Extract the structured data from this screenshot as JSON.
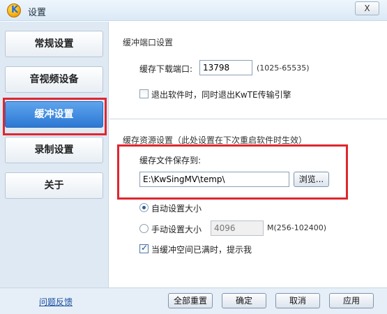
{
  "window": {
    "title": "设置",
    "close_glyph": "X"
  },
  "sidebar": {
    "items": [
      {
        "label": "常规设置",
        "active": false
      },
      {
        "label": "音视频设备",
        "active": false
      },
      {
        "label": "缓冲设置",
        "active": true
      },
      {
        "label": "录制设置",
        "active": false
      },
      {
        "label": "关于",
        "active": false
      }
    ]
  },
  "buffer_port": {
    "section_title": "缓冲端口设置",
    "port_label": "缓存下载端口:",
    "port_value": "13798",
    "port_range": "(1025-65535)",
    "exit_checkbox_label": "退出软件时，同时退出KwTE传输引擎",
    "exit_checkbox_checked": false
  },
  "buffer_resource": {
    "section_title": "缓存资源设置（此处设置在下次重启软件时生效）",
    "save_to_label": "缓存文件保存到:",
    "path_value": "E:\\KwSingMV\\temp\\",
    "browse_label": "浏览...",
    "auto_size_label": "自动设置大小",
    "auto_size_selected": true,
    "manual_size_label": "手动设置大小",
    "manual_size_selected": false,
    "manual_size_value": "4096",
    "manual_size_range": "M(256-102400)",
    "notify_full_label": "当缓冲空间已满时，提示我",
    "notify_full_checked": true
  },
  "footer": {
    "feedback_link": "问题反馈",
    "reset_all_label": "全部重置",
    "ok_label": "确定",
    "cancel_label": "取消",
    "apply_label": "应用"
  },
  "colors": {
    "highlight_box": "#e0262e",
    "active_tab": "#2c78d4",
    "sidebar_bg": "#dfe9f4"
  },
  "icons": {
    "app": "kwsing-logo-icon",
    "close": "close-icon"
  }
}
